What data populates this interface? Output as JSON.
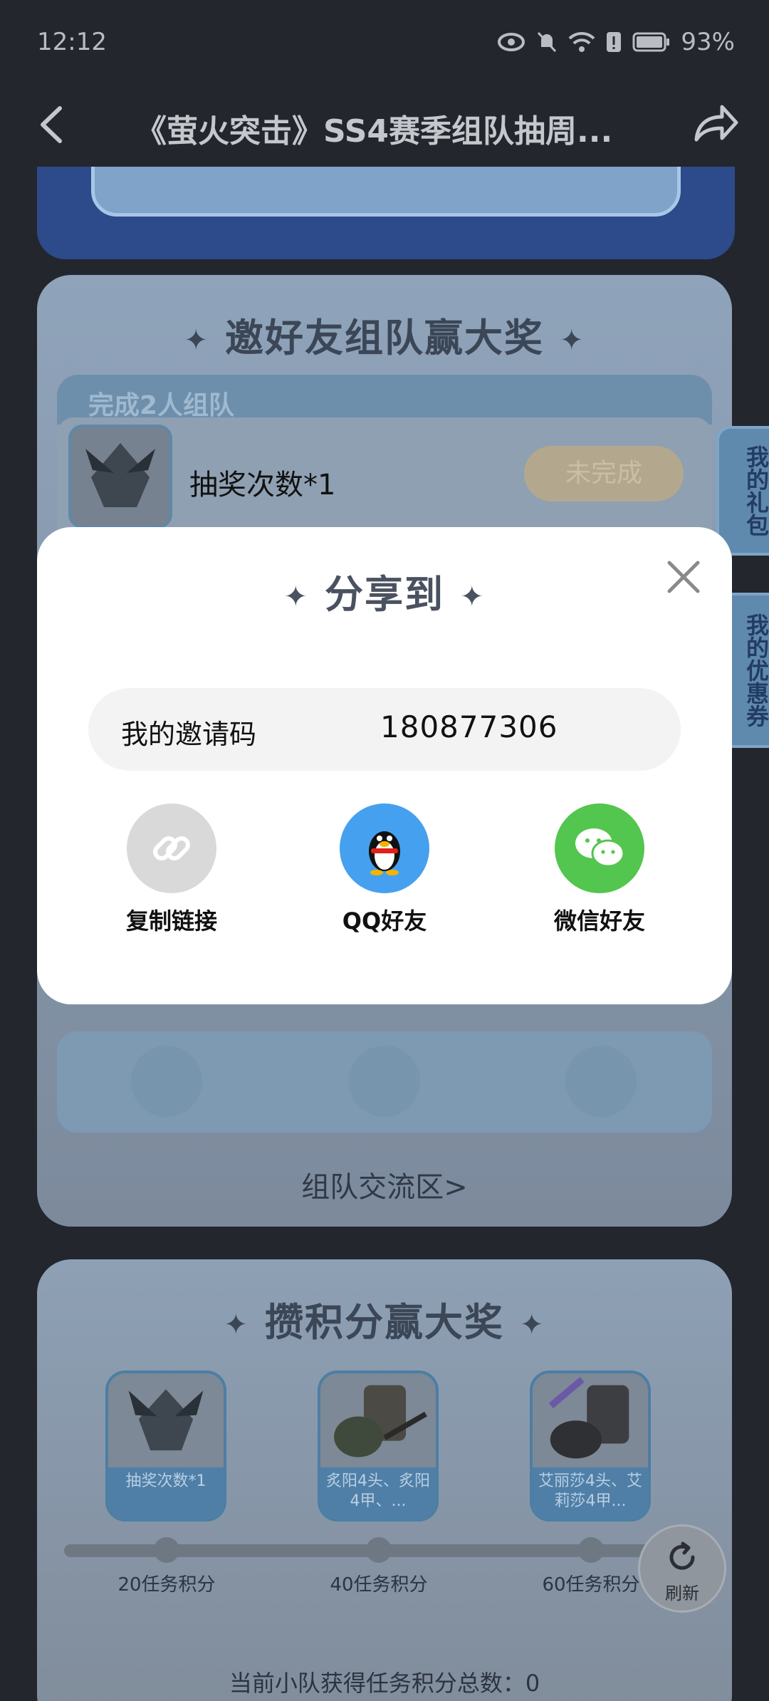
{
  "status_bar": {
    "time": "12:12",
    "battery": "93%"
  },
  "nav": {
    "title": "《萤火突击》SS4赛季组队抽周..."
  },
  "invite_card": {
    "title": "邀好友组队赢大奖",
    "task_tab": "完成2人组队",
    "task_label": "抽奖次数*1",
    "task_status": "未完成",
    "exchange_link": "组队交流区>"
  },
  "points_card": {
    "title": "攒积分赢大奖",
    "rewards": [
      {
        "caption": "抽奖次数*1",
        "milestone": "20任务积分"
      },
      {
        "caption": "炙阳4头、炙阳4甲、...",
        "milestone": "40任务积分"
      },
      {
        "caption": "艾丽莎4头、艾莉莎4甲...",
        "milestone": "60任务积分"
      }
    ],
    "total_label": "当前小队获得任务积分总数：0"
  },
  "side_tabs": {
    "gift": "我的礼包",
    "coupon": "我的优惠券"
  },
  "refresh": {
    "label": "刷新"
  },
  "share_modal": {
    "title": "分享到",
    "invite_label": "我的邀请码",
    "invite_code": "180877306",
    "options": [
      {
        "label": "复制链接",
        "icon": "link-icon",
        "color": "#d9d9d9"
      },
      {
        "label": "QQ好友",
        "icon": "qq-penguin-icon",
        "color": "#46a0f0"
      },
      {
        "label": "微信好友",
        "icon": "wechat-icon",
        "color": "#52c64e"
      }
    ]
  }
}
